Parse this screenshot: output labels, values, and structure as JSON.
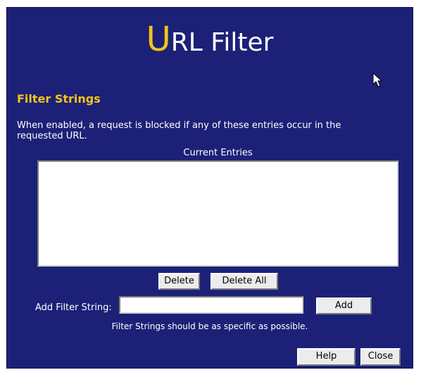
{
  "page": {
    "title_first_letter": "U",
    "title_rest": "RL Filter",
    "section_heading": "Filter Strings",
    "description": "When enabled, a request is blocked if any of these entries occur in the requested URL.",
    "entries_label": "Current Entries",
    "entries": [],
    "add_label": "Add Filter String:",
    "add_value": "",
    "hint": "Filter Strings should be as specific as possible."
  },
  "buttons": {
    "delete": "Delete",
    "delete_all": "Delete All",
    "add": "Add",
    "help": "Help",
    "close": "Close"
  },
  "icons": {
    "cursor": "mouse-pointer-icon"
  },
  "colors": {
    "background": "#1c2177",
    "accent": "#f5c518",
    "text": "#ffffff",
    "button_face": "#ececec"
  }
}
